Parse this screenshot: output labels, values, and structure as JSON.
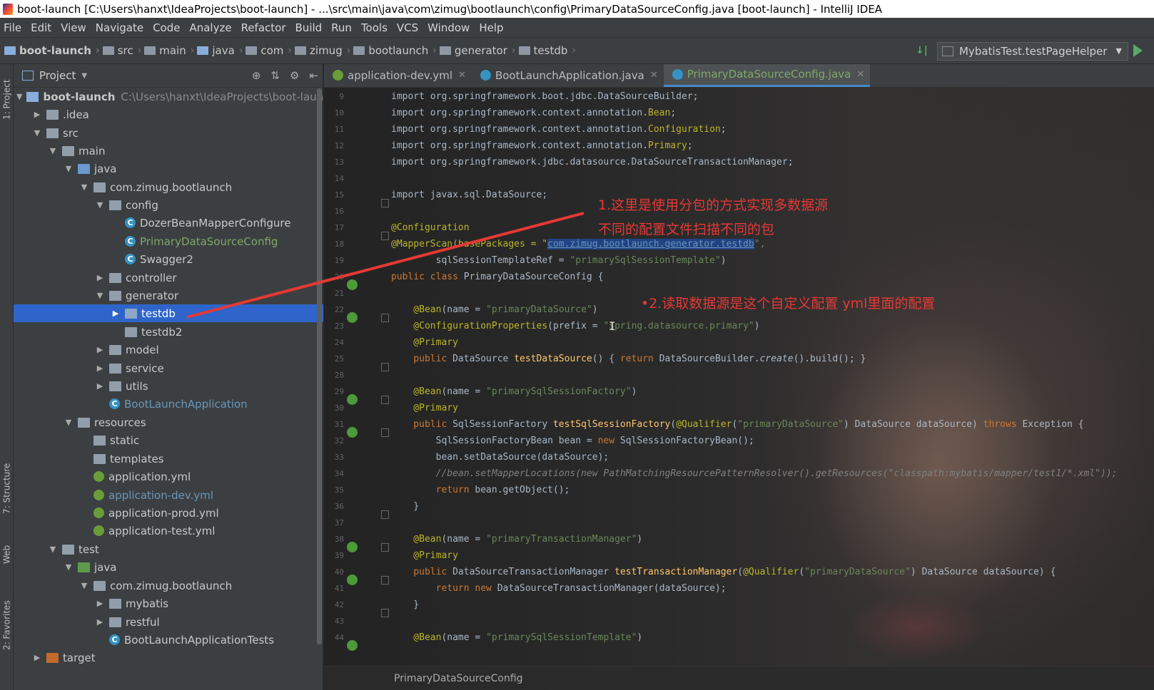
{
  "window": {
    "title": "boot-launch [C:\\Users\\hanxt\\IdeaProjects\\boot-launch] - ...\\src\\main\\java\\com\\zimug\\bootlaunch\\config\\PrimaryDataSourceConfig.java [boot-launch] - IntelliJ IDEA"
  },
  "menu": [
    "File",
    "Edit",
    "View",
    "Navigate",
    "Code",
    "Analyze",
    "Refactor",
    "Build",
    "Run",
    "Tools",
    "VCS",
    "Window",
    "Help"
  ],
  "breadcrumbs": [
    "boot-launch",
    "src",
    "main",
    "java",
    "com",
    "zimug",
    "bootlaunch",
    "generator",
    "testdb"
  ],
  "run_config": "MybatisTest.testPageHelper",
  "side_tabs": {
    "project": "1: Project",
    "structure": "7: Structure",
    "web": "Web",
    "favorites": "2: Favorites"
  },
  "project_panel": {
    "title": "Project",
    "root_path": "C:\\Users\\hanxt\\IdeaProjects\\boot-launch",
    "nodes": [
      "boot-launch",
      ".idea",
      "src",
      "main",
      "java",
      "com.zimug.bootlaunch",
      "config",
      "DozerBeanMapperConfigure",
      "PrimaryDataSourceConfig",
      "Swagger2",
      "controller",
      "generator",
      "testdb",
      "testdb2",
      "model",
      "service",
      "utils",
      "BootLaunchApplication",
      "resources",
      "static",
      "templates",
      "application.yml",
      "application-dev.yml",
      "application-prod.yml",
      "application-test.yml",
      "test",
      "java",
      "com.zimug.bootlaunch",
      "mybatis",
      "restful",
      "BootLaunchApplicationTests",
      "target"
    ]
  },
  "tabs": [
    "application-dev.yml",
    "BootLaunchApplication.java",
    "PrimaryDataSourceConfig.java"
  ],
  "line_numbers": [
    "9",
    "10",
    "11",
    "12",
    "13",
    "14",
    "15",
    "16",
    "17",
    "18",
    "19",
    "20",
    "21",
    "22",
    "23",
    "24",
    "25",
    "28",
    "29",
    "30",
    "31",
    "32",
    "33",
    "34",
    "35",
    "36",
    "37",
    "38",
    "39",
    "40",
    "41",
    "42",
    "43",
    "44"
  ],
  "code": {
    "l9": "import org.springframework.boot.jdbc.DataSourceBuilder;",
    "l10a": "import org.springframework.context.annotation.",
    "l10b": "Bean",
    "l10c": ";",
    "l11a": "import org.springframework.context.annotation.",
    "l11b": "Configuration",
    "l11c": ";",
    "l12a": "import org.springframework.context.annotation.",
    "l12b": "Primary",
    "l12c": ";",
    "l13": "import org.springframework.jdbc.datasource.DataSourceTransactionManager;",
    "l15": "import javax.sql.DataSource;",
    "l17": "@Configuration",
    "l18a": "@MapperScan(basePackages = \"",
    "l18b": "com.zimug.bootlaunch.generator.testdb",
    "l18c": "\",",
    "l19a": "        sqlSessionTemplateRef = ",
    "l19b": "\"primarySqlSessionTemplate\"",
    "l19c": ")",
    "l20a": "public class ",
    "l20b": "PrimaryDataSourceConfig {",
    "l22a": "    @Bean",
    "l22b": "(name = ",
    "l22c": "\"primaryDataSource\"",
    "l22d": ")",
    "l23a": "    @ConfigurationProperties",
    "l23b": "(prefix = ",
    "l23c": "\"spring.datasource.primary\"",
    "l23d": ")",
    "l24": "    @Primary",
    "l25a": "    public ",
    "l25b": "DataSource ",
    "l25c": "testDataSource",
    "l25d": "() { ",
    "l25e": "return ",
    "l25f": "DataSourceBuilder.",
    "l25g": "create",
    "l25h": "().build(); }",
    "l29a": "    @Bean",
    "l29b": "(name = ",
    "l29c": "\"primarySqlSessionFactory\"",
    "l29d": ")",
    "l30": "    @Primary",
    "l31a": "    public ",
    "l31b": "SqlSessionFactory ",
    "l31c": "testSqlSessionFactory",
    "l31d": "(",
    "l31e": "@Qualifier",
    "l31f": "(",
    "l31g": "\"primaryDataSource\"",
    "l31h": ") DataSource dataSource) ",
    "l31i": "throws ",
    "l31j": "Exception {",
    "l32a": "        SqlSessionFactoryBean bean = ",
    "l32b": "new ",
    "l32c": "SqlSessionFactoryBean();",
    "l33": "        bean.setDataSource(dataSource);",
    "l34": "        //bean.setMapperLocations(new PathMatchingResourcePatternResolver().getResources(\"classpath:mybatis/mapper/test1/*.xml\"));",
    "l35a": "        return ",
    "l35b": "bean.getObject();",
    "l36": "    }",
    "l38a": "    @Bean",
    "l38b": "(name = ",
    "l38c": "\"primaryTransactionManager\"",
    "l38d": ")",
    "l39": "    @Primary",
    "l40a": "    public ",
    "l40b": "DataSourceTransactionManager ",
    "l40c": "testTransactionManager",
    "l40d": "(",
    "l40e": "@Qualifier",
    "l40f": "(",
    "l40g": "\"primaryDataSource\"",
    "l40h": ") DataSource dataSource) {",
    "l41a": "        return new ",
    "l41b": "DataSourceTransactionManager(dataSource);",
    "l42": "    }",
    "l44a": "    @Bean",
    "l44b": "(name = ",
    "l44c": "\"primarySqlSessionTemplate\"",
    "l44d": ")"
  },
  "editor_breadcrumb": "PrimaryDataSourceConfig",
  "annotations": {
    "a1_line1": "1.这里是使用分包的方式实现多数据源",
    "a1_line2": "不同的配置文件扫描不同的包",
    "a2": "•2.读取数据源是这个自定义配置 yml里面的配置"
  },
  "colors": {
    "annotation": "#e53935",
    "selection": "#2f65ca",
    "active_tab_underline": "#4a88c7"
  }
}
